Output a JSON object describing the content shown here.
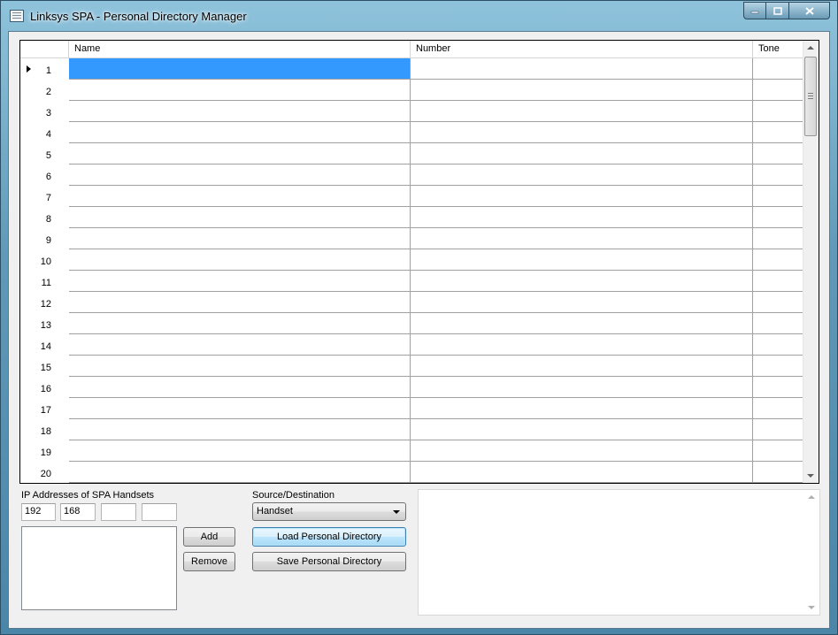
{
  "window": {
    "title": "Linksys SPA - Personal Directory Manager",
    "icons": {
      "app": "app-icon",
      "minimize": "minimize-icon",
      "maximize": "maximize-icon",
      "close": "close-icon"
    }
  },
  "grid": {
    "columns": [
      "Name",
      "Number",
      "Tone"
    ],
    "rows": [
      "1",
      "2",
      "3",
      "4",
      "5",
      "6",
      "7",
      "8",
      "9",
      "10",
      "11",
      "12",
      "13",
      "14",
      "15",
      "16",
      "17",
      "18",
      "19",
      "20"
    ],
    "selected_row": "1",
    "selection_color": "#3399ff"
  },
  "handsets": {
    "label": "IP Addresses of SPA Handsets",
    "ip_octets": [
      "192",
      "168",
      "",
      ""
    ],
    "add_label": "Add",
    "remove_label": "Remove"
  },
  "source": {
    "label": "Source/Destination",
    "selected": "Handset",
    "load_label": "Load Personal Directory",
    "save_label": "Save Personal Directory"
  }
}
